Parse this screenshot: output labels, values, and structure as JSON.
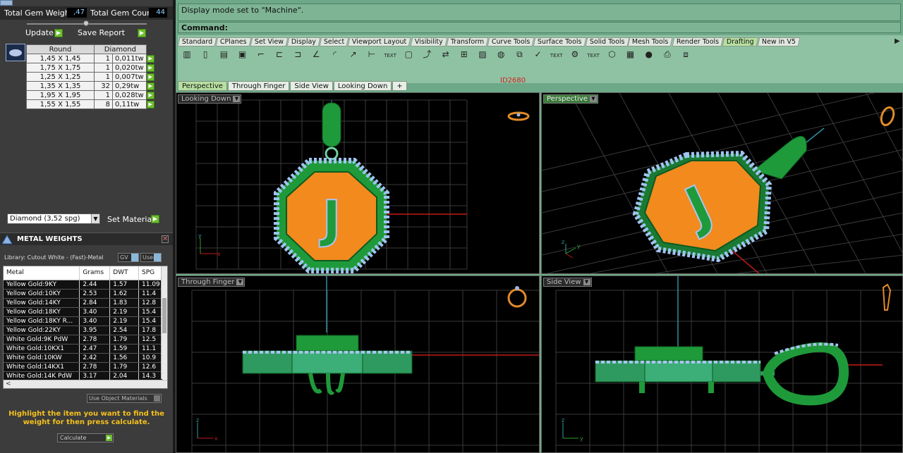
{
  "gem_summary": {
    "total_weight_label": "Total Gem Weight",
    "total_weight_value": ",47",
    "total_count_label": "Total Gem Count",
    "total_count_value": "44",
    "update_label": "Update",
    "save_report_label": "Save Report"
  },
  "gem_table": {
    "col_shape": "Round",
    "col_type": "Diamond",
    "rows": [
      {
        "size": "1,45 X 1,45",
        "qty": "1",
        "weight": "0,011tw"
      },
      {
        "size": "1,75 X 1,75",
        "qty": "1",
        "weight": "0,020tw"
      },
      {
        "size": "1,25 X 1,25",
        "qty": "1",
        "weight": "0,007tw"
      },
      {
        "size": "1,35 X 1,35",
        "qty": "32",
        "weight": "0,29tw"
      },
      {
        "size": "1,95 X 1,95",
        "qty": "1",
        "weight": "0,028tw"
      },
      {
        "size": "1,55 X 1,55",
        "qty": "8",
        "weight": "0,11tw"
      }
    ]
  },
  "material": {
    "selected": "Diamond    (3,52 spg)",
    "set_label": "Set Material"
  },
  "metal_weights": {
    "title": "METAL WEIGHTS",
    "library": "Library: Cutout White - (Fast)-Metal",
    "unit_select": "GV",
    "user_select": "User",
    "columns": [
      "Metal",
      "Grams",
      "DWT",
      "SPG"
    ],
    "rows": [
      [
        "Yellow Gold:9KY",
        "2.44",
        "1.57",
        "11.09"
      ],
      [
        "Yellow Gold:10KY",
        "2.53",
        "1.62",
        "11.4"
      ],
      [
        "Yellow Gold:14KY",
        "2.84",
        "1.83",
        "12.8"
      ],
      [
        "Yellow Gold:18KY",
        "3.40",
        "2.19",
        "15.4"
      ],
      [
        "Yellow Gold:18KY R...",
        "3.40",
        "2.19",
        "15.4"
      ],
      [
        "Yellow Gold:22KY",
        "3.95",
        "2.54",
        "17.8"
      ],
      [
        "White Gold:9K PdW",
        "2.78",
        "1.79",
        "12.5"
      ],
      [
        "White Gold:10KX1",
        "2.47",
        "1.59",
        "11.1"
      ],
      [
        "White Gold:10KW",
        "2.42",
        "1.56",
        "10.9"
      ],
      [
        "White Gold:14KX1",
        "2.78",
        "1.79",
        "12.6"
      ],
      [
        "White Gold:14K PdW",
        "3.17",
        "2.04",
        "14.3"
      ]
    ],
    "use_object_materials": "Use Object Materials",
    "hint": "Highlight the item you want to find the weight for then press calculate.",
    "calculate_label": "Calculate"
  },
  "command": {
    "history": "Display mode set to \"Machine\".",
    "prompt": "Command:"
  },
  "toolbar_tabs": [
    "Standard",
    "CPlanes",
    "Set View",
    "Display",
    "Select",
    "Viewport Layout",
    "Visibility",
    "Transform",
    "Curve Tools",
    "Surface Tools",
    "Solid Tools",
    "Mesh Tools",
    "Render Tools",
    "Drafting",
    "New in V5"
  ],
  "active_toolbar_tab": "Drafting",
  "viewport_tabs": [
    "Perspective",
    "Through Finger",
    "Side View",
    "Looking Down",
    "+"
  ],
  "object_id": "ID2680",
  "viewports": {
    "top_left": "Looking Down",
    "top_right": "Perspective",
    "bottom_left": "Through Finger",
    "bottom_right": "Side View"
  },
  "letter": "J",
  "colors": {
    "metal_green": "#1f9a3a",
    "gem_blue": "#a9c4f0",
    "face_orange": "#f28a1e",
    "axis_red": "#c41a1a",
    "axis_green": "#2fa02f",
    "grid": "#3a3a3a"
  }
}
